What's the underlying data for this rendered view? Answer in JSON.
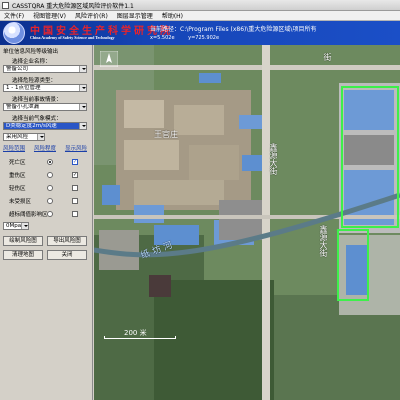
{
  "window": {
    "title": "CASSTQRA 重大危险源区域风险评价软件1.1"
  },
  "menu": [
    "文件(F)",
    "视图管理(V)",
    "风险评价(R)",
    "图层显示管理",
    "帮助(H)"
  ],
  "banner": {
    "org_cn": "中国安全生产科学研究院",
    "org_en": "China Academy of Safety Science and Technology",
    "current_path": "当前路径：C:\\Program Files (x86)\\重大危险源区域\\项目所有",
    "coord_x": "x=5.502e",
    "coord_y": "y=725.902e"
  },
  "left_panel": {
    "section1_title": "单位信息风险等级输出",
    "enterprise_label": "选择企业名称：",
    "enterprise_value": "警备公司",
    "hazard_label": "选择危险源类型：",
    "hazard_value": "1 - 1点位管理",
    "scenario_label": "选择当前事故情景：",
    "scenario_value": "警备小孔泄漏",
    "weather_label": "选择当前气象模式：",
    "weather_value": "D类稳定度2m/s风速",
    "risk_value": "采用风险",
    "tabs": [
      "风险范围",
      "风险程度",
      "显示风险"
    ],
    "layers": [
      {
        "name": "死亡区",
        "radio": true,
        "check": true,
        "blue": true
      },
      {
        "name": "重伤区",
        "radio": false,
        "check": true,
        "blue": false
      },
      {
        "name": "轻伤区",
        "radio": false,
        "check": false,
        "blue": false
      },
      {
        "name": "未受损区",
        "radio": false,
        "check": false,
        "blue": false
      },
      {
        "name": "超标阈值影响区",
        "radio": false,
        "check": false,
        "blue": false
      }
    ],
    "mpa_value": "0Mpa",
    "buttons": {
      "draw": "绘制风险图",
      "export": "导出风险图",
      "clear": "清理地图",
      "close": "关闭"
    }
  },
  "map": {
    "place_village": "王官庄",
    "road_upper": "鑫源大街",
    "road_lower": "鑫源大街",
    "river": "纸 坊 河",
    "scale": "200 米",
    "north": "N"
  },
  "colors": {
    "banner": "#1646b8",
    "org_cn": "#e8232b",
    "highlight": "#2a56c6",
    "risk_outline": "#3df04a"
  }
}
